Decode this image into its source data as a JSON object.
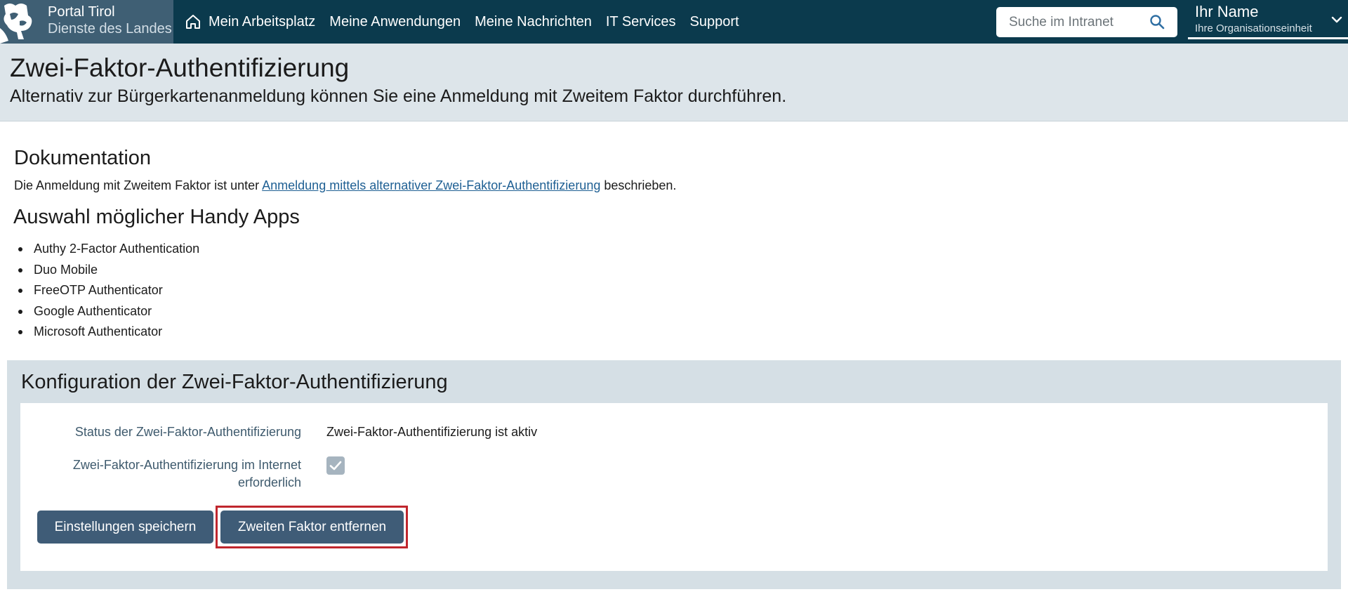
{
  "brand": {
    "line1": "Portal Tirol",
    "line2": "Dienste des Landes"
  },
  "nav": {
    "items": [
      {
        "label": "Mein Arbeitsplatz",
        "icon": "home-icon"
      },
      {
        "label": "Meine Anwendungen"
      },
      {
        "label": "Meine Nachrichten"
      },
      {
        "label": "IT Services"
      },
      {
        "label": "Support"
      }
    ]
  },
  "search": {
    "placeholder": "Suche im Intranet",
    "icon": "search-icon"
  },
  "user": {
    "name": "Ihr Name",
    "organisation": "Ihre Organisationseinheit",
    "icon": "chevron-down-icon"
  },
  "header": {
    "title": "Zwei-Faktor-Authentifizierung",
    "subtitle": "Alternativ zur Bürgerkartenanmeldung können Sie eine Anmeldung mit Zweitem Faktor durchführen."
  },
  "documentation": {
    "heading": "Dokumentation",
    "text_before": "Die Anmeldung mit Zweitem Faktor ist unter ",
    "link": "Anmeldung mittels alternativer Zwei-Faktor-Authentifizierung",
    "text_after": " beschrieben."
  },
  "apps": {
    "heading": "Auswahl möglicher Handy Apps",
    "items": [
      "Authy 2-Factor Authentication",
      "Duo Mobile",
      "FreeOTP Authenticator",
      "Google Authenticator",
      "Microsoft Authenticator"
    ]
  },
  "config": {
    "heading": "Konfiguration der Zwei-Faktor-Authentifizierung",
    "status_label": "Status der Zwei-Faktor-Authentifizierung",
    "status_value": "Zwei-Faktor-Authentifizierung ist aktiv",
    "internet_label_line1": "Zwei-Faktor-Authentifizierung im Internet",
    "internet_label_line2": "erforderlich",
    "internet_required": true,
    "save_button": "Einstellungen speichern",
    "remove_button": "Zweiten Faktor entfernen"
  },
  "colors": {
    "topbar": "#0b3a4d",
    "brand_bg": "#3f5f74",
    "header_bg": "#dde5ea",
    "panel_bg": "#d5dfe5",
    "button_bg": "#3f5c77",
    "link": "#1e5f93",
    "highlight": "#c0262d"
  }
}
